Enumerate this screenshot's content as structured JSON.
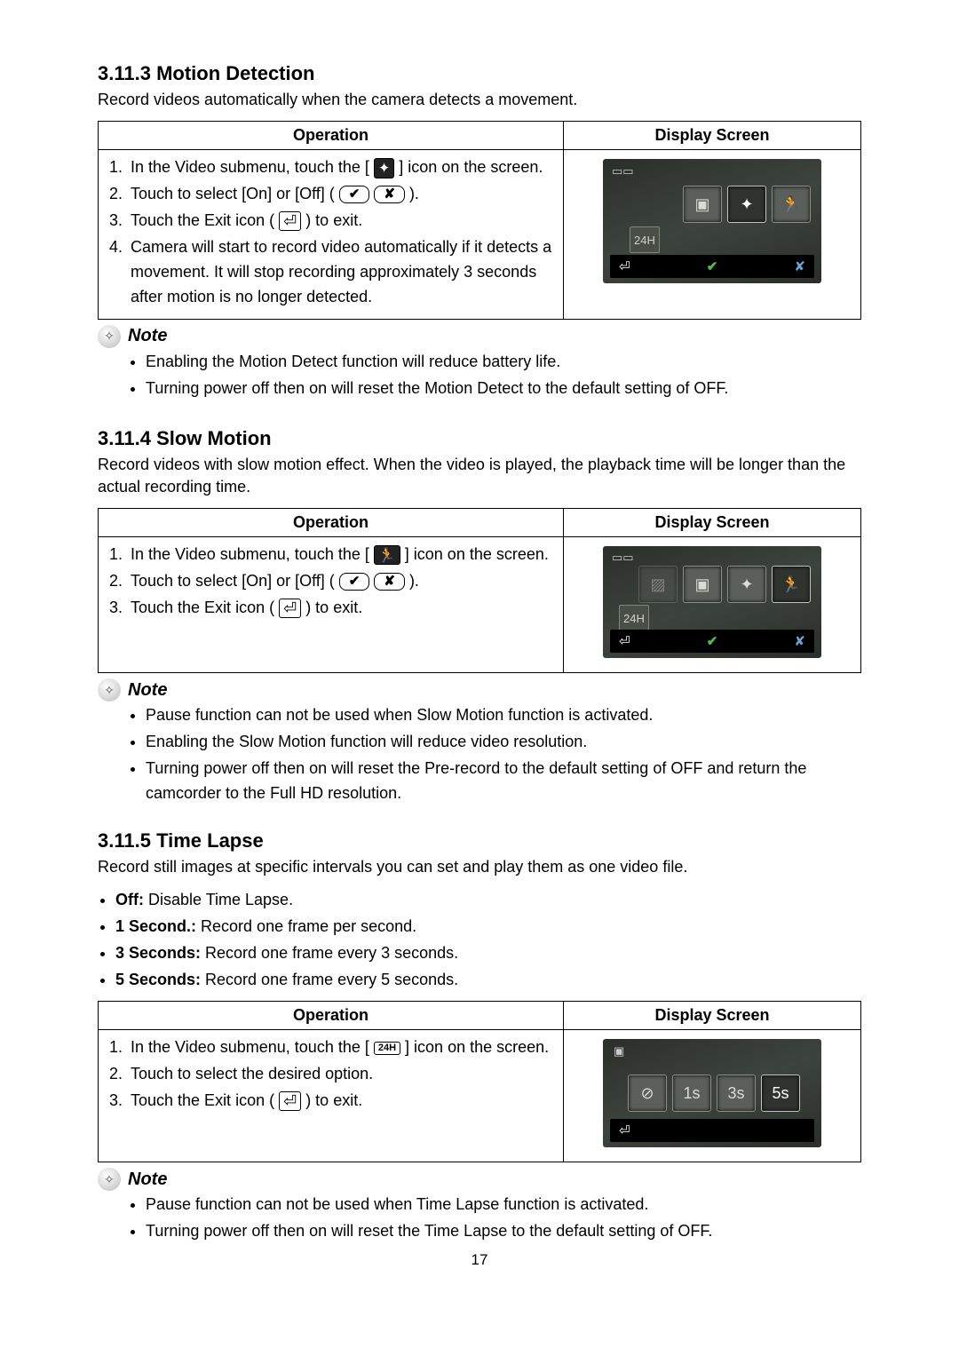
{
  "page_number": "17",
  "sections": {
    "motion": {
      "heading": "3.11.3  Motion Detection",
      "intro": "Record videos automatically when the camera detects a movement.",
      "table": {
        "col1": "Operation",
        "col2": "Display Screen",
        "steps": {
          "s1a": "In the Video submenu, touch the [ ",
          "s1b": " ] icon on the screen.",
          "s2a": "Touch to select [On] or [Off] ( ",
          "s2b": " ).",
          "s3a": "Touch the Exit icon ( ",
          "s3b": " ) to exit.",
          "s4": "Camera will start to record video automatically if it detects a movement. It will stop recording approximately 3 seconds after motion is no longer detected."
        }
      },
      "note_title": "Note",
      "notes": {
        "n1": "Enabling the Motion Detect function will reduce battery life.",
        "n2": "Turning power off then on will reset the Motion Detect to the default setting of OFF."
      }
    },
    "slow": {
      "heading": "3.11.4  Slow Motion",
      "intro": "Record videos with slow motion effect. When the video is played, the playback time will be longer than the actual recording time.",
      "table": {
        "col1": "Operation",
        "col2": "Display Screen",
        "steps": {
          "s1a": "In the Video submenu, touch the [ ",
          "s1b": " ] icon on the screen.",
          "s2a": "Touch to select [On] or [Off] ( ",
          "s2b": " ).",
          "s3a": "Touch the Exit icon ( ",
          "s3b": " ) to exit."
        }
      },
      "note_title": "Note",
      "notes": {
        "n1": "Pause function can not be used when Slow Motion function is activated.",
        "n2": "Enabling the Slow Motion function will reduce video resolution.",
        "n3": "Turning power off then on will reset the Pre-record to the default setting of OFF and return the camcorder to the Full HD resolution."
      }
    },
    "timelapse": {
      "heading": "3.11.5  Time Lapse",
      "intro": "Record still images at specific intervals you can set and play them as one video file.",
      "options": {
        "o1l": "Off:",
        "o1t": " Disable Time Lapse.",
        "o2l": "1 Second.:",
        "o2t": " Record one frame per second.",
        "o3l": "3 Seconds:",
        "o3t": " Record one frame every 3 seconds.",
        "o4l": "5 Seconds:",
        "o4t": " Record one frame every 5 seconds."
      },
      "table": {
        "col1": "Operation",
        "col2": "Display Screen",
        "steps": {
          "s1a": "In the Video submenu, touch the [ ",
          "s1b": " ] icon on the screen.",
          "s2": "Touch to select the desired option.",
          "s3a": "Touch the Exit icon ( ",
          "s3b": " ) to exit."
        }
      },
      "note_title": "Note",
      "notes": {
        "n1": "Pause function can not be used when Time Lapse function is activated.",
        "n2": "Turning power off then on will reset the Time Lapse to the default setting of OFF."
      }
    }
  },
  "icons": {
    "motion": "✦",
    "slow": "🏃",
    "timelapse": "24H",
    "check": "✔",
    "cross": "✘",
    "exit": "⏎"
  }
}
